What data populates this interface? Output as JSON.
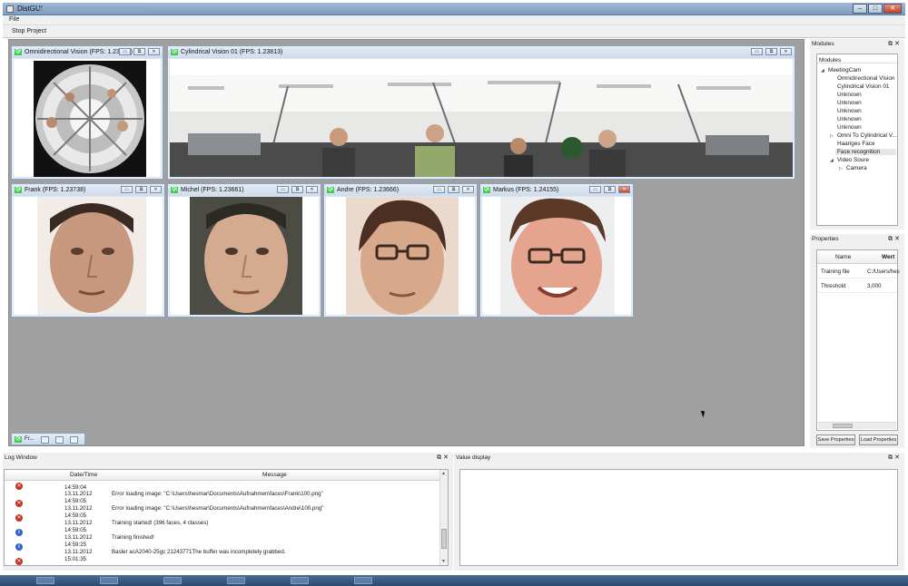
{
  "window": {
    "title": "DistGUI"
  },
  "menu": {
    "file": "File"
  },
  "toolbar": {
    "stop_project": "Stop Project"
  },
  "windows": {
    "omni": {
      "title": "Omnidirectional Vision (FPS: 1.23765)"
    },
    "cyl": {
      "title": "Cylindrical Vision 01 (FPS: 1.23813)"
    },
    "frank": {
      "title": "Frank (FPS: 1.23738)"
    },
    "michel": {
      "title": "Michel (FPS: 1.23661)"
    },
    "andre": {
      "title": "Andre (FPS: 1.23666)"
    },
    "markus": {
      "title": "Markus (FPS: 1.24155)"
    },
    "minimized": {
      "title": "Fr..."
    }
  },
  "modules": {
    "dock_title": "Modules",
    "tree_header": "Modules",
    "items": [
      "MeetingCam",
      "Omnidirectional Vision",
      "Cylindrical Vision 01",
      "Unknown",
      "Unknown",
      "Unknown",
      "Unknown",
      "Unknown",
      "Omni To Cylindrical V...",
      "Haariges Face",
      "Face recognition",
      "Video Soure",
      "Camera"
    ]
  },
  "properties": {
    "dock_title": "Properties",
    "col_name": "Name",
    "col_value": "Wert",
    "rows": [
      {
        "name": "Training file",
        "value": "C:/Users/hes"
      },
      {
        "name": "Threshold",
        "value": "3,000"
      }
    ],
    "save": "Save Properties",
    "load": "Load Properties"
  },
  "log": {
    "dock_title": "Log Window",
    "col_date": "Date/Time",
    "col_msg": "Message",
    "rows": [
      {
        "level": "error",
        "date": "",
        "time": "14:59:04",
        "msg": ""
      },
      {
        "level": "error",
        "date": "13.11.2012",
        "time": "14:59:05",
        "msg": "Error loading image: \"C:\\Users\\hesmar\\Documents\\Aufnahmen\\faces\\Frank\\100.png\""
      },
      {
        "level": "error",
        "date": "13.11.2012",
        "time": "14:59:05",
        "msg": "Error loading image: \"C:\\Users\\hesmar\\Documents\\Aufnahmen\\faces\\Andre\\100.png\""
      },
      {
        "level": "info",
        "date": "13.11.2012",
        "time": "14:59:05",
        "msg": "Training started! (396 faces, 4 classes)"
      },
      {
        "level": "info",
        "date": "13.11.2012",
        "time": "14:59:25",
        "msg": "Training finished!"
      },
      {
        "level": "error",
        "date": "13.11.2012",
        "time": "15:01:35",
        "msg": "Basler acA2040-25gc 21243771The buffer was incompletely grabbed."
      }
    ]
  },
  "value_display": {
    "dock_title": "Value display"
  },
  "colors": {
    "title_bar": "#7d9cc2",
    "mdi_bg": "#a0a0a0",
    "qt_green": "#41cd52",
    "error": "#c8302a",
    "info": "#2f64c8"
  }
}
